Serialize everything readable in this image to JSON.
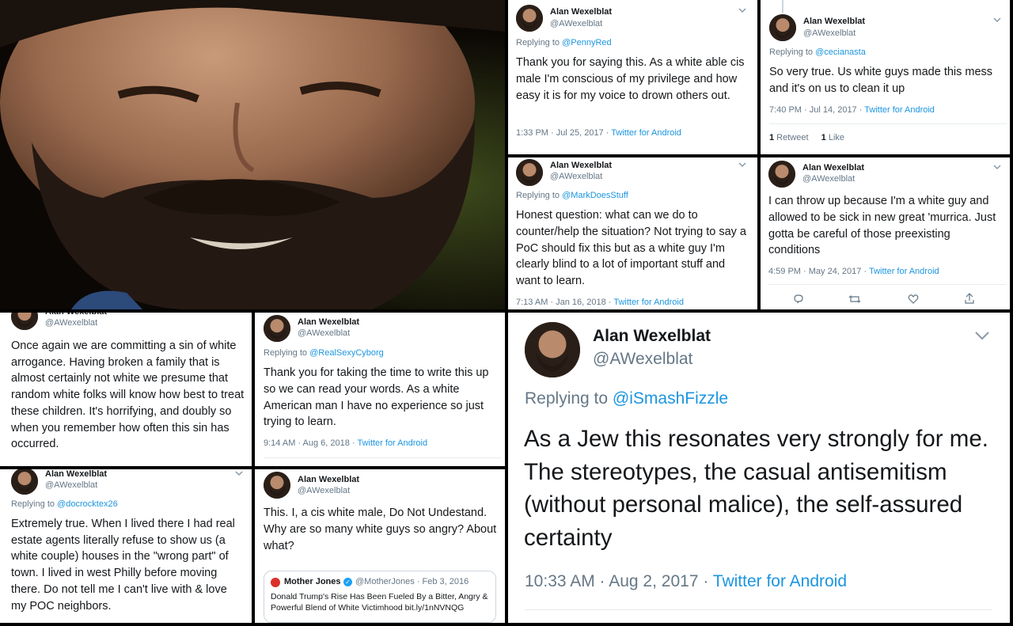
{
  "colors": {
    "link": "#1b95e0",
    "muted": "#657786",
    "text": "#14171a",
    "background": "#000000"
  },
  "author": {
    "name": "Alan Wexelblat",
    "handle": "@AWexelblat"
  },
  "photo": {
    "icon": "portrait-photo"
  },
  "tweets": [
    {
      "reply_prefix": "Replying to ",
      "reply_to": "@PennyRed",
      "text": "Thank you for saying this. As a white able cis male I'm conscious of my privilege and how easy it is for my voice to drown others out.",
      "time": "1:33 PM · Jul 25, 2017 · ",
      "source": "Twitter for Android"
    },
    {
      "reply_prefix": "Replying to ",
      "reply_to": "@cecianasta",
      "text": "So very true. Us white guys made this mess and it's on us to clean it up",
      "time": "7:40 PM · Jul 14, 2017 · ",
      "source": "Twitter for Android",
      "retweets": "1",
      "retweets_label": " Retweet",
      "likes": "1",
      "likes_label": " Like"
    },
    {
      "reply_prefix": "Replying to ",
      "reply_to": "@MarkDoesStuff",
      "text": "Honest question: what can we do to counter/help the situation? Not trying to say a PoC should fix this but as a white guy I'm clearly blind to a lot of important stuff and want to learn.",
      "time": "7:13 AM · Jan 16, 2018 · ",
      "source": "Twitter for Android"
    },
    {
      "text": "I can throw up because I'm a white guy and allowed to be sick in new great 'murrica. Just gotta be careful of those preexisting conditions",
      "time": "4:59 PM · May 24, 2017 · ",
      "source": "Twitter for Android"
    },
    {
      "text": "Once again we are committing a sin of white arrogance. Having broken a family that is almost certainly not white we presume that random white folks will know how best to treat these children. It's horrifying, and doubly so when you remember how often this sin has occurred."
    },
    {
      "reply_prefix": "Replying to ",
      "reply_to": "@RealSexyCyborg",
      "text": "Thank you for taking the time to write this up so we can read your words. As a white American man I have no experience so just trying to learn.",
      "time": "9:14 AM · Aug 6, 2018 · ",
      "source": "Twitter for Android"
    },
    {
      "reply_prefix": "Replying to ",
      "reply_to": "@iSmashFizzle",
      "text": "As a Jew this resonates very strongly for me. The stereotypes, the casual antisemitism (without personal malice), the self-assured certainty",
      "time": "10:33 AM · Aug 2, 2017 · ",
      "source": "Twitter for Android"
    },
    {
      "reply_prefix": "Replying to ",
      "reply_to": "@docrocktex26",
      "text": "Extremely true. When I lived there I had real estate agents literally refuse to show us (a white couple) houses in the \"wrong part\" of town. I lived in west Philly before moving there. Do not tell me I can't live with & love my POC neighbors."
    },
    {
      "text": "This. I, a cis white male, Do Not Undestand. Why are so many white guys so angry? About what?",
      "quote": {
        "name": "Mother Jones",
        "handle": "@MotherJones",
        "date": " · Feb 3, 2016",
        "text": "Donald Trump's Rise Has Been Fueled By a Bitter, Angry & Powerful Blend of White Victimhood bit.ly/1nNVNQG"
      }
    }
  ]
}
